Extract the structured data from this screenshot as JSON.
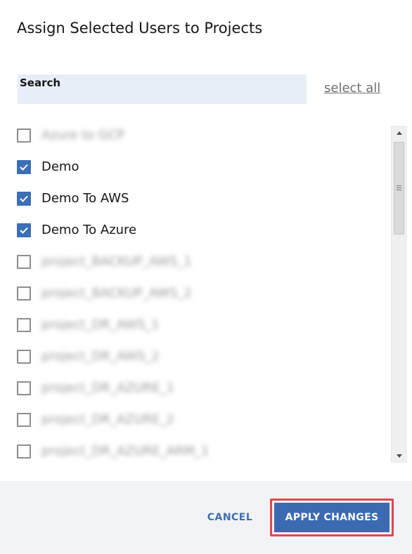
{
  "dialog": {
    "title": "Assign Selected Users to Projects"
  },
  "search": {
    "label": "Search",
    "value": "",
    "placeholder": ""
  },
  "select_all_label": "select all",
  "projects": [
    {
      "label": "Azure to GCP",
      "checked": false,
      "blurred": true
    },
    {
      "label": "Demo",
      "checked": true,
      "blurred": false
    },
    {
      "label": "Demo To AWS",
      "checked": true,
      "blurred": false
    },
    {
      "label": "Demo To Azure",
      "checked": true,
      "blurred": false
    },
    {
      "label": "project_BACKUP_AWS_1",
      "checked": false,
      "blurred": true
    },
    {
      "label": "project_BACKUP_AWS_2",
      "checked": false,
      "blurred": true
    },
    {
      "label": "project_DR_AWS_1",
      "checked": false,
      "blurred": true
    },
    {
      "label": "project_DR_AWS_2",
      "checked": false,
      "blurred": true
    },
    {
      "label": "project_DR_AZURE_1",
      "checked": false,
      "blurred": true
    },
    {
      "label": "project_DR_AZURE_2",
      "checked": false,
      "blurred": true
    },
    {
      "label": "project_DR_AZURE_ARM_1",
      "checked": false,
      "blurred": true
    }
  ],
  "footer": {
    "cancel_label": "CANCEL",
    "apply_label": "APPLY CHANGES"
  },
  "colors": {
    "accent": "#3c6ab0",
    "highlight_outline": "#e0474c",
    "footer_bg": "#f1f3f6",
    "search_bg": "#e8eef7"
  }
}
